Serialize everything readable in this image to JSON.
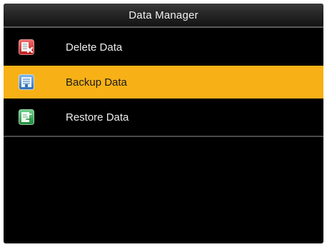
{
  "header": {
    "title": "Data Manager"
  },
  "menu": {
    "items": [
      {
        "label": "Delete Data",
        "icon": "delete-data-icon",
        "selected": false
      },
      {
        "label": "Backup Data",
        "icon": "backup-data-icon",
        "selected": true
      },
      {
        "label": "Restore Data",
        "icon": "restore-data-icon",
        "selected": false
      }
    ]
  },
  "colors": {
    "background": "#000000",
    "selection": "#f7b116",
    "text": "#ededed",
    "selected_text": "#1a1a1a"
  }
}
